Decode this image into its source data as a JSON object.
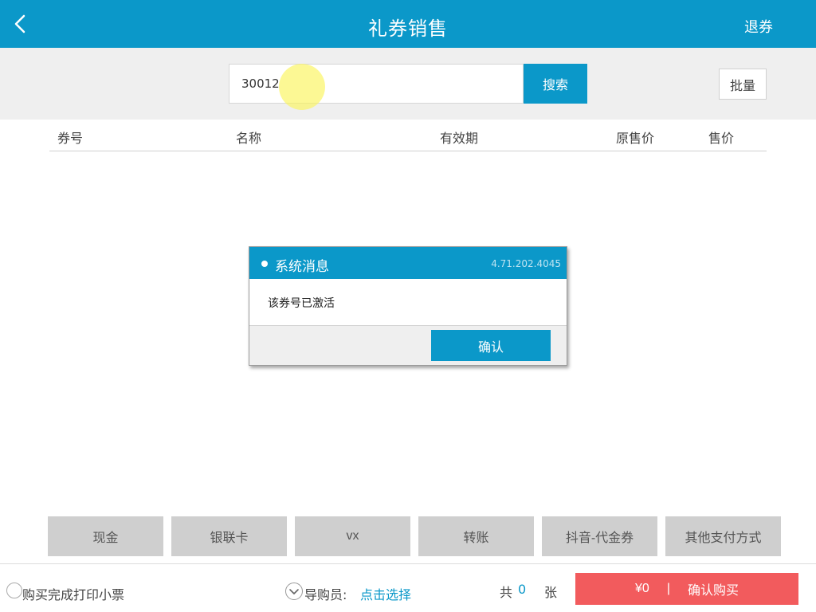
{
  "header": {
    "title": "礼券销售",
    "back_icon": "chevron-left-icon",
    "right_action": "退券"
  },
  "search": {
    "value": "30012",
    "button_label": "搜索",
    "batch_label": "批量"
  },
  "table": {
    "columns": [
      "券号",
      "名称",
      "有效期",
      "原售价",
      "售价"
    ]
  },
  "dialog": {
    "title": "系统消息",
    "version": "4.71.202.4045",
    "message": "该券号已激活",
    "confirm_label": "确认"
  },
  "payment_methods": [
    "现金",
    "银联卡",
    "vx",
    "转账",
    "抖音-代金券",
    "其他支付方式"
  ],
  "footer": {
    "print_receipt_label": "购买完成打印小票",
    "guide_label": "导购员:",
    "guide_select_label": "点击选择",
    "total_prefix": "共",
    "total_count": "0",
    "total_suffix": "张",
    "amount": "¥0",
    "separator": "|",
    "buy_label": "确认购买"
  },
  "colors": {
    "primary": "#0b98c9",
    "buy": "#f25b5d",
    "payment_bg": "#cfcfcf"
  }
}
